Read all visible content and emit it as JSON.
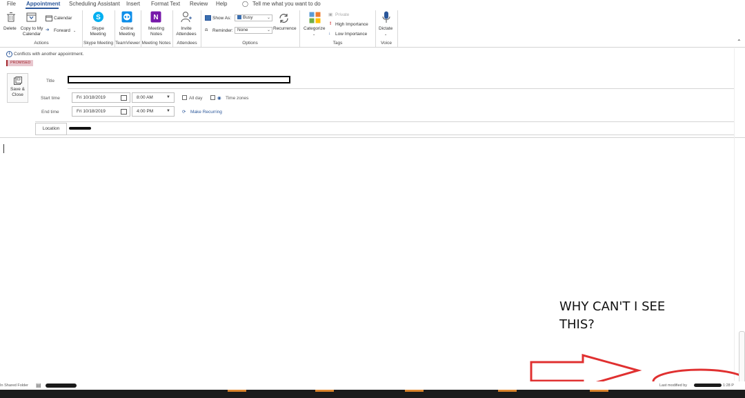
{
  "menu": {
    "items": [
      "File",
      "Appointment",
      "Scheduling Assistant",
      "Insert",
      "Format Text",
      "Review",
      "Help"
    ],
    "tell_me": "Tell me what you want to do"
  },
  "ribbon": {
    "actions": {
      "delete": "Delete",
      "copy_to_my_calendar": "Copy to My Calendar",
      "calendar": "Calendar",
      "forward": "Forward",
      "group": "Actions"
    },
    "skype": {
      "label": "Skype Meeting",
      "group": "Skype Meeting"
    },
    "teamviewer": {
      "label": "Online Meeting",
      "group": "TeamViewer"
    },
    "meeting_notes": {
      "label": "Meeting Notes",
      "group": "Meeting Notes"
    },
    "attendees": {
      "label": "Invite Attendees",
      "group": "Attendees"
    },
    "options": {
      "show_as_label": "Show As:",
      "show_as_value": "Busy",
      "reminder_label": "Reminder:",
      "reminder_value": "None",
      "recurrence": "Recurrence",
      "group": "Options"
    },
    "tags": {
      "categorize": "Categorize",
      "private": "Private",
      "high_importance": "High Importance",
      "low_importance": "Low Importance",
      "group": "Tags"
    },
    "voice": {
      "dictate": "Dictate",
      "group": "Voice"
    }
  },
  "info": {
    "conflict": "Conflicts with another appointment.",
    "tag": "PROMISED"
  },
  "form": {
    "save_close": "Save & Close",
    "title_label": "Title",
    "start_label": "Start time",
    "end_label": "End time",
    "start_date": "Fri 10/18/2019",
    "start_time": "8:00 AM",
    "end_date": "Fri 10/18/2019",
    "end_time": "4:00 PM",
    "all_day": "All day",
    "time_zones": "Time zones",
    "make_recurring": "Make Recurring",
    "location_label": "Location"
  },
  "annotation": {
    "text": "WHY CAN'T I SEE\nTHIS?"
  },
  "status": {
    "shared_folder": "In Shared Folder",
    "last_modified": "Last modified by",
    "time_fragment": "1:28 P"
  },
  "colors": {
    "accent": "#2b579a",
    "annotation_red": "#e03030"
  }
}
